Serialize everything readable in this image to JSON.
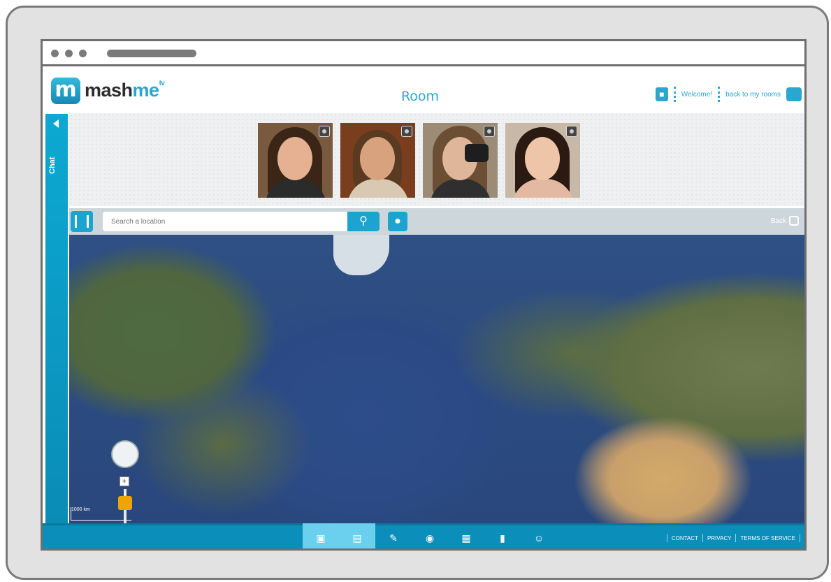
{
  "header": {
    "logo_text_main": "mash",
    "logo_text_accent": "me",
    "logo_tv": "tv",
    "room_title": "Room",
    "welcome_text": "Welcome!",
    "back_rooms_text": "back to my rooms"
  },
  "chat": {
    "label": "Chat"
  },
  "participants": [
    "participant-1",
    "participant-2",
    "participant-3",
    "participant-4"
  ],
  "toolbar": {
    "search_placeholder": "Search a location",
    "back_label": "Back"
  },
  "map": {
    "zoom_plus": "+",
    "zoom_minus": "-",
    "scale_label": "1000 km"
  },
  "footer": {
    "icons": [
      "chat-icon",
      "notes-icon",
      "edit-icon",
      "globe-icon",
      "map-icon",
      "chart-icon",
      "share-icon"
    ],
    "links": [
      "CONTACT",
      "PRIVACY",
      "TERMS OF SERVICE"
    ]
  },
  "colors": {
    "accent": "#2aa7cf",
    "footer": "#0b8fba",
    "toolbar": "#cdd6db"
  }
}
